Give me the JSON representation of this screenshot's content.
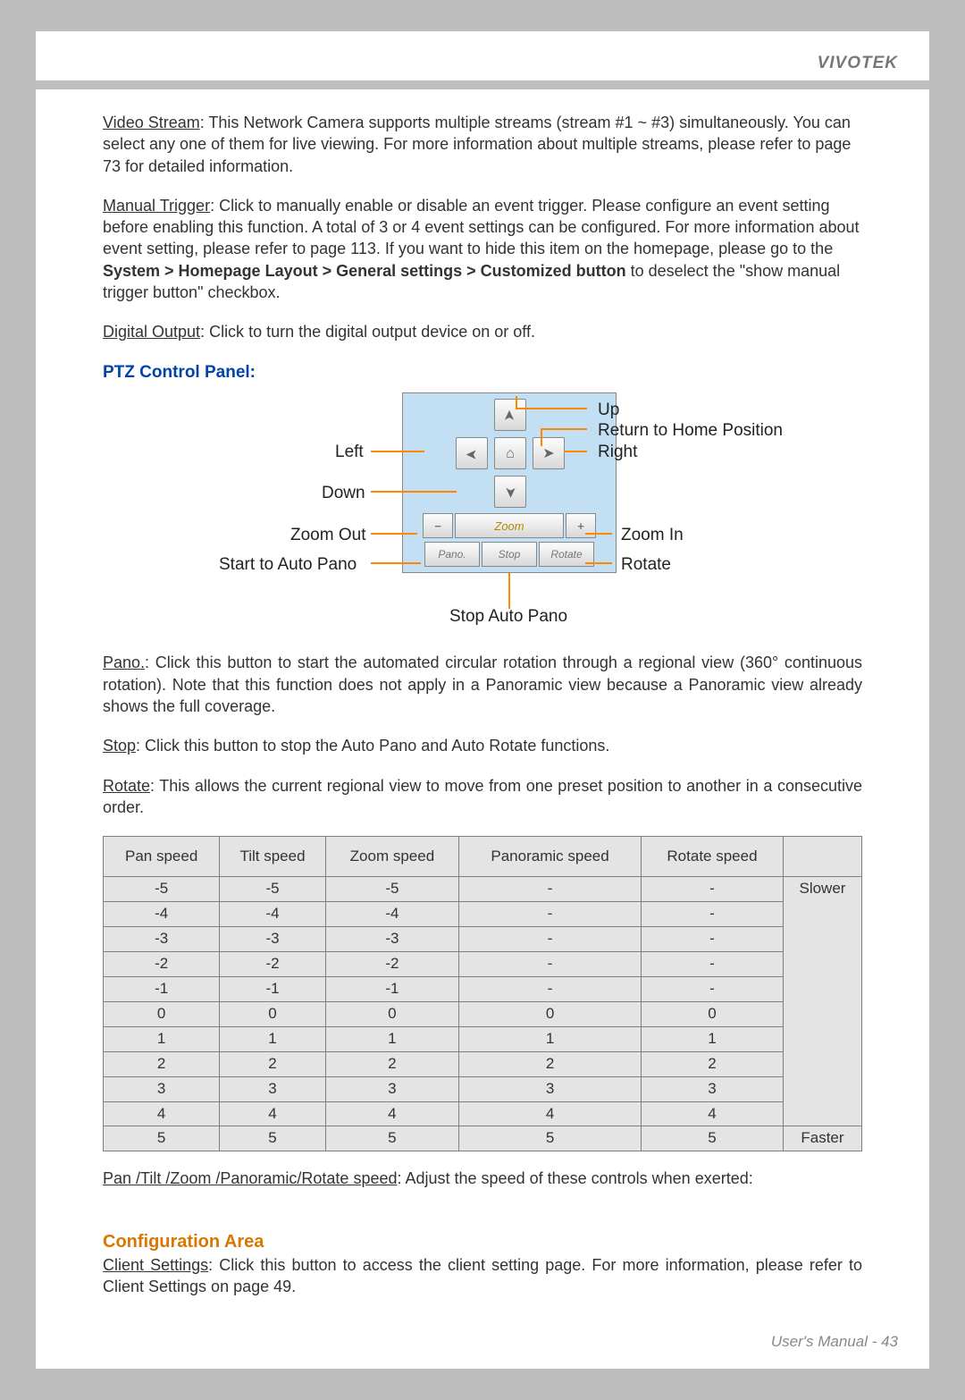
{
  "header": {
    "brand": "VIVOTEK"
  },
  "footer": {
    "text": "User's Manual - 43"
  },
  "videoStream": {
    "label": "Video Stream",
    "text": ": This Network Camera supports multiple streams (stream #1 ~ #3) simultaneously. You can select any one of them for live viewing. For more information about multiple streams, please refer to page 73 for detailed information."
  },
  "manualTrigger": {
    "label": "Manual Trigger",
    "text1": ": Click to manually enable or disable an event trigger. Please configure an event setting before enabling this function. A total of 3 or 4 event settings can be configured. For more information about event setting, please refer to page 113.  If you want to hide this item on the homepage, please go to the ",
    "bold": "System > Homepage Layout > General settings > Customized button",
    "text2": " to deselect the \"show manual trigger button\" checkbox."
  },
  "digitalOutput": {
    "label": "Digital Output",
    "text": ": Click to turn the digital output device on or off."
  },
  "ptz": {
    "heading": "PTZ Control Panel:",
    "labels": {
      "up": "Up",
      "returnHome": "Return to Home Position",
      "left": "Left",
      "right": "Right",
      "down": "Down",
      "zoomOut": "Zoom Out",
      "zoomIn": "Zoom In",
      "startAutoPano": "Start to Auto Pano",
      "rotate": "Rotate",
      "stopAutoPano": "Stop Auto Pano"
    },
    "buttons": {
      "zoom": "Zoom",
      "pano": "Pano.",
      "stop": "Stop",
      "rotateBtn": "Rotate"
    }
  },
  "pano": {
    "label": "Pano.",
    "text": ": Click this button to start the automated circular rotation through a regional view (360° continuous rotation). Note that this function does not apply in a Panoramic view because a Panoramic view already shows the full coverage."
  },
  "stop": {
    "label": "Stop",
    "text": ": Click this button to stop the Auto Pano and Auto Rotate functions."
  },
  "rotate": {
    "label": "Rotate",
    "text": ": This allows the current regional view to move from one preset position to another in a consecutive order."
  },
  "speedTable": {
    "headers": [
      "Pan speed",
      "Tilt speed",
      "Zoom speed",
      "Panoramic speed",
      "Rotate speed",
      ""
    ],
    "tags": {
      "slower": "Slower",
      "faster": "Faster"
    },
    "rows": [
      [
        "-5",
        "-5",
        "-5",
        "-",
        "-"
      ],
      [
        "-4",
        "-4",
        "-4",
        "-",
        "-"
      ],
      [
        "-3",
        "-3",
        "-3",
        "-",
        "-"
      ],
      [
        "-2",
        "-2",
        "-2",
        "-",
        "-"
      ],
      [
        "-1",
        "-1",
        "-1",
        "-",
        "-"
      ],
      [
        "0",
        "0",
        "0",
        "0",
        "0"
      ],
      [
        "1",
        "1",
        "1",
        "1",
        "1"
      ],
      [
        "2",
        "2",
        "2",
        "2",
        "2"
      ],
      [
        "3",
        "3",
        "3",
        "3",
        "3"
      ],
      [
        "4",
        "4",
        "4",
        "4",
        "4"
      ],
      [
        "5",
        "5",
        "5",
        "5",
        "5"
      ]
    ]
  },
  "speedNote": {
    "label": "Pan /Tilt /Zoom /Panoramic/Rotate speed",
    "text": ": Adjust the speed of these controls when exerted:"
  },
  "configArea": {
    "heading": "Configuration Area",
    "csLabel": "Client Settings",
    "csText": ": Click this button to access the client setting page. For more information, please refer to Client Settings on page 49."
  }
}
